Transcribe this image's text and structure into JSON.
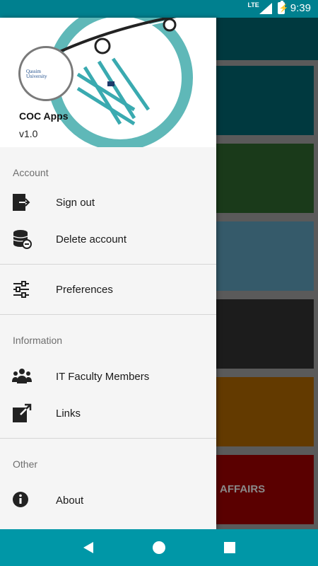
{
  "status_bar": {
    "network": "LTE",
    "time": "9:39"
  },
  "header": {
    "app_name": "COC Apps",
    "version": "v1.0",
    "logo_lines": [
      "Qassim",
      "University"
    ]
  },
  "sections": {
    "account": {
      "title": "Account",
      "items": [
        {
          "label": "Sign out",
          "icon": "sign-out-icon"
        },
        {
          "label": "Delete account",
          "icon": "database-remove-icon"
        }
      ]
    },
    "preferences": {
      "items": [
        {
          "label": "Preferences",
          "icon": "sliders-icon"
        }
      ]
    },
    "information": {
      "title": "Information",
      "items": [
        {
          "label": "IT Faculty Members",
          "icon": "group-icon"
        },
        {
          "label": "Links",
          "icon": "external-link-icon"
        }
      ]
    },
    "other": {
      "title": "Other",
      "items": [
        {
          "label": "About",
          "icon": "info-icon"
        }
      ]
    }
  },
  "background_tiles": [
    {
      "color": "#00393f",
      "label": ""
    },
    {
      "color": "#1a3a1a",
      "label": ""
    },
    {
      "color": "#355a6a",
      "label": ""
    },
    {
      "color": "#1c1c1c",
      "label": ""
    },
    {
      "color": "#633a00",
      "label": ""
    },
    {
      "color": "#5a0000",
      "label": "AFFAIRS"
    }
  ],
  "colors": {
    "status_bar": "#00808f",
    "nav_bar": "#0097a7",
    "drawer_bg": "#f5f5f5"
  }
}
